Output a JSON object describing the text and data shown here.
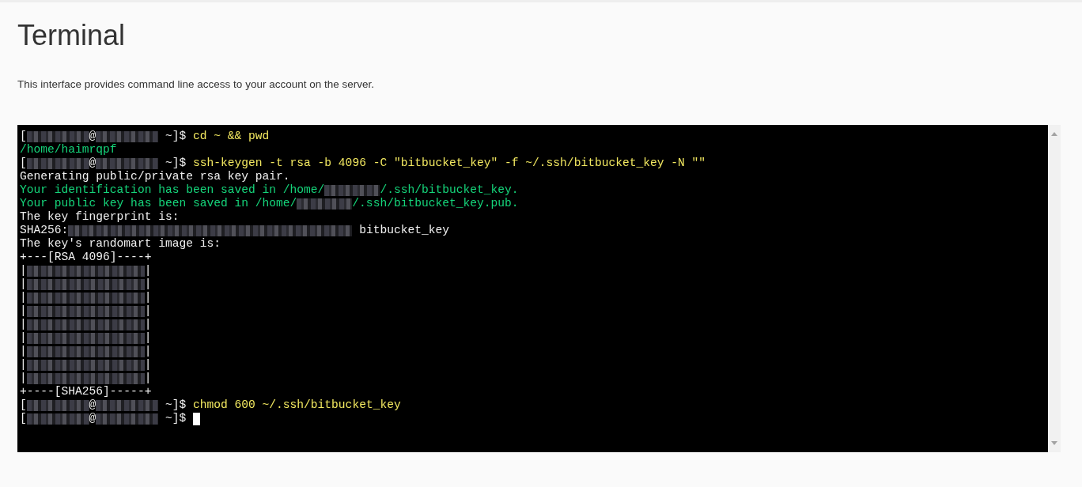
{
  "page": {
    "title": "Terminal",
    "description": "This interface provides command line access to your account on the server."
  },
  "terminal": {
    "lines": [
      {
        "segments": [
          {
            "kind": "plain",
            "text": "["
          },
          {
            "kind": "user"
          },
          {
            "kind": "plain",
            "text": "@"
          },
          {
            "kind": "host"
          },
          {
            "kind": "plain",
            "text": " ~]$ "
          },
          {
            "kind": "command",
            "text": "cd ~ && pwd"
          }
        ]
      },
      {
        "segments": [
          {
            "kind": "output",
            "text": "/home/haimrqpf"
          }
        ]
      },
      {
        "segments": [
          {
            "kind": "plain",
            "text": "["
          },
          {
            "kind": "user"
          },
          {
            "kind": "plain",
            "text": "@"
          },
          {
            "kind": "host"
          },
          {
            "kind": "plain",
            "text": " ~]$ "
          },
          {
            "kind": "command",
            "text": "ssh-keygen -t rsa -b 4096 -C \"bitbucket_key\" -f ~/.ssh/bitbucket_key -N \"\""
          }
        ]
      },
      {
        "segments": [
          {
            "kind": "plain",
            "text": "Generating public/private rsa key pair."
          }
        ]
      },
      {
        "segments": [
          {
            "kind": "output",
            "text": "Your identification has been saved in /home/"
          },
          {
            "kind": "home"
          },
          {
            "kind": "output",
            "text": "/.ssh/bitbucket_key."
          }
        ]
      },
      {
        "segments": [
          {
            "kind": "output",
            "text": "Your public key has been saved in /home/"
          },
          {
            "kind": "home"
          },
          {
            "kind": "output",
            "text": "/.ssh/bitbucket_key.pub."
          }
        ]
      },
      {
        "segments": [
          {
            "kind": "plain",
            "text": "The key fingerprint is:"
          }
        ]
      },
      {
        "segments": [
          {
            "kind": "plain",
            "text": "SHA256:"
          },
          {
            "kind": "hash"
          },
          {
            "kind": "plain",
            "text": " bitbucket_key"
          }
        ]
      },
      {
        "segments": [
          {
            "kind": "plain",
            "text": "The key's randomart image is:"
          }
        ]
      },
      {
        "segments": [
          {
            "kind": "plain",
            "text": "+---[RSA 4096]----+"
          }
        ]
      },
      {
        "segments": [
          {
            "kind": "plain",
            "text": "|"
          },
          {
            "kind": "art"
          },
          {
            "kind": "plain",
            "text": "|"
          }
        ]
      },
      {
        "segments": [
          {
            "kind": "plain",
            "text": "|"
          },
          {
            "kind": "art"
          },
          {
            "kind": "plain",
            "text": "|"
          }
        ]
      },
      {
        "segments": [
          {
            "kind": "plain",
            "text": "|"
          },
          {
            "kind": "art"
          },
          {
            "kind": "plain",
            "text": "|"
          }
        ]
      },
      {
        "segments": [
          {
            "kind": "plain",
            "text": "|"
          },
          {
            "kind": "art"
          },
          {
            "kind": "plain",
            "text": "|"
          }
        ]
      },
      {
        "segments": [
          {
            "kind": "plain",
            "text": "|"
          },
          {
            "kind": "art"
          },
          {
            "kind": "plain",
            "text": "|"
          }
        ]
      },
      {
        "segments": [
          {
            "kind": "plain",
            "text": "|"
          },
          {
            "kind": "art"
          },
          {
            "kind": "plain",
            "text": "|"
          }
        ]
      },
      {
        "segments": [
          {
            "kind": "plain",
            "text": "|"
          },
          {
            "kind": "art"
          },
          {
            "kind": "plain",
            "text": "|"
          }
        ]
      },
      {
        "segments": [
          {
            "kind": "plain",
            "text": "|"
          },
          {
            "kind": "art"
          },
          {
            "kind": "plain",
            "text": "|"
          }
        ]
      },
      {
        "segments": [
          {
            "kind": "plain",
            "text": "|"
          },
          {
            "kind": "art"
          },
          {
            "kind": "plain",
            "text": "|"
          }
        ]
      },
      {
        "segments": [
          {
            "kind": "plain",
            "text": "+----[SHA256]-----+"
          }
        ]
      },
      {
        "segments": [
          {
            "kind": "plain",
            "text": "["
          },
          {
            "kind": "user"
          },
          {
            "kind": "plain",
            "text": "@"
          },
          {
            "kind": "host"
          },
          {
            "kind": "plain",
            "text": " ~]$ "
          },
          {
            "kind": "command",
            "text": "chmod 600 ~/.ssh/bitbucket_key"
          }
        ]
      },
      {
        "segments": [
          {
            "kind": "plain",
            "text": "["
          },
          {
            "kind": "user"
          },
          {
            "kind": "plain",
            "text": "@"
          },
          {
            "kind": "host"
          },
          {
            "kind": "plain",
            "text": " ~]$ "
          },
          {
            "kind": "cursor"
          }
        ]
      }
    ]
  }
}
